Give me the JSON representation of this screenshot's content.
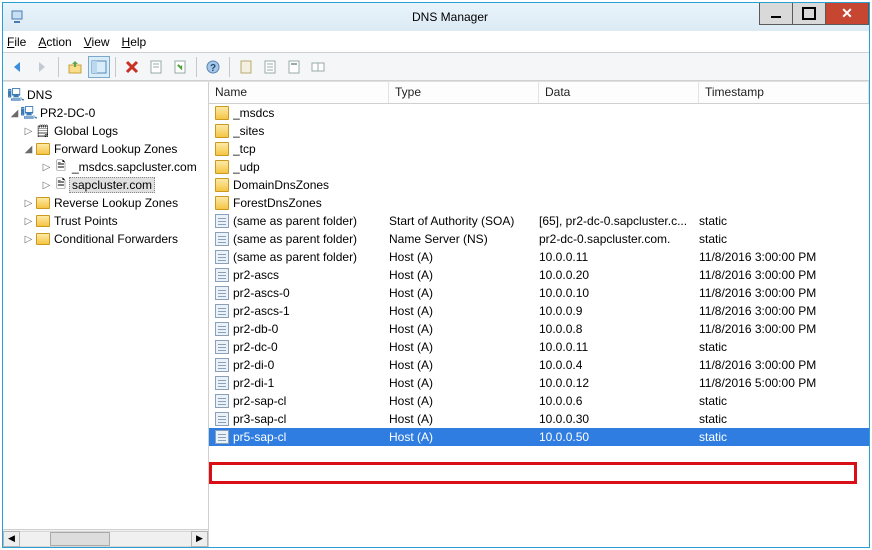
{
  "window": {
    "title": "DNS Manager"
  },
  "menu": {
    "file": "File",
    "action": "Action",
    "view": "View",
    "help": "Help"
  },
  "tree": {
    "root": "DNS",
    "server": "PR2-DC-0",
    "global_logs": "Global Logs",
    "fwd": "Forward Lookup Zones",
    "z1": "_msdcs.sapcluster.com",
    "z2": "sapcluster.com",
    "rev": "Reverse Lookup Zones",
    "tp": "Trust Points",
    "cf": "Conditional Forwarders"
  },
  "cols": {
    "name": "Name",
    "type": "Type",
    "data": "Data",
    "ts": "Timestamp"
  },
  "folders": [
    "_msdcs",
    "_sites",
    "_tcp",
    "_udp",
    "DomainDnsZones",
    "ForestDnsZones"
  ],
  "records": [
    {
      "name": "(same as parent folder)",
      "type": "Start of Authority (SOA)",
      "data": "[65], pr2-dc-0.sapcluster.c...",
      "ts": "static"
    },
    {
      "name": "(same as parent folder)",
      "type": "Name Server (NS)",
      "data": "pr2-dc-0.sapcluster.com.",
      "ts": "static"
    },
    {
      "name": "(same as parent folder)",
      "type": "Host (A)",
      "data": "10.0.0.11",
      "ts": "11/8/2016 3:00:00 PM"
    },
    {
      "name": "pr2-ascs",
      "type": "Host (A)",
      "data": "10.0.0.20",
      "ts": "11/8/2016 3:00:00 PM"
    },
    {
      "name": "pr2-ascs-0",
      "type": "Host (A)",
      "data": "10.0.0.10",
      "ts": "11/8/2016 3:00:00 PM"
    },
    {
      "name": "pr2-ascs-1",
      "type": "Host (A)",
      "data": "10.0.0.9",
      "ts": "11/8/2016 3:00:00 PM"
    },
    {
      "name": "pr2-db-0",
      "type": "Host (A)",
      "data": "10.0.0.8",
      "ts": "11/8/2016 3:00:00 PM"
    },
    {
      "name": "pr2-dc-0",
      "type": "Host (A)",
      "data": "10.0.0.11",
      "ts": "static"
    },
    {
      "name": "pr2-di-0",
      "type": "Host (A)",
      "data": "10.0.0.4",
      "ts": "11/8/2016 3:00:00 PM"
    },
    {
      "name": "pr2-di-1",
      "type": "Host (A)",
      "data": "10.0.0.12",
      "ts": "11/8/2016 5:00:00 PM"
    },
    {
      "name": "pr2-sap-cl",
      "type": "Host (A)",
      "data": "10.0.0.6",
      "ts": "static"
    },
    {
      "name": "pr3-sap-cl",
      "type": "Host (A)",
      "data": "10.0.0.30",
      "ts": "static"
    },
    {
      "name": "pr5-sap-cl",
      "type": "Host (A)",
      "data": "10.0.0.50",
      "ts": "static",
      "selected": true
    }
  ]
}
